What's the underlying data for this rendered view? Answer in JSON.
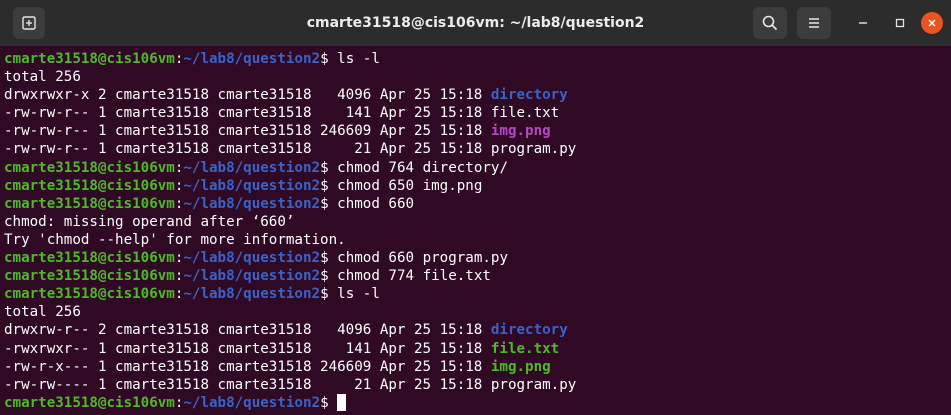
{
  "window": {
    "title": "cmarte31518@cis106vm: ~/lab8/question2",
    "icons": {
      "new_tab": "new-tab-icon",
      "search": "search-icon",
      "menu": "hamburger-menu-icon",
      "minimize": "minimize-icon",
      "maximize": "maximize-icon",
      "close": "close-icon"
    }
  },
  "colors": {
    "background": "#300a24",
    "titlebar": "#2c2c2c",
    "prompt_user": "#4dba27",
    "prompt_path": "#3a63c9",
    "directory": "#3a63c9",
    "image": "#b748c4",
    "executable": "#4dba27",
    "close_button": "#e95420"
  },
  "prompt": {
    "user_host": "cmarte31518@cis106vm",
    "colon": ":",
    "path": "~/lab8/question2",
    "dollar": "$"
  },
  "lines": [
    {
      "kind": "prompt",
      "cmd": " ls -l"
    },
    {
      "kind": "text",
      "text": "total 256"
    },
    {
      "kind": "ls",
      "meta": "drwxrwxr-x 2 cmarte31518 cmarte31518   4096 Apr 25 15:18 ",
      "name": "directory",
      "type": "dir"
    },
    {
      "kind": "ls",
      "meta": "-rw-rw-r-- 1 cmarte31518 cmarte31518    141 Apr 25 15:18 ",
      "name": "file.txt",
      "type": "plain"
    },
    {
      "kind": "ls",
      "meta": "-rw-rw-r-- 1 cmarte31518 cmarte31518 246609 Apr 25 15:18 ",
      "name": "img.png",
      "type": "pic"
    },
    {
      "kind": "ls",
      "meta": "-rw-rw-r-- 1 cmarte31518 cmarte31518     21 Apr 25 15:18 ",
      "name": "program.py",
      "type": "plain"
    },
    {
      "kind": "prompt",
      "cmd": " chmod 764 directory/"
    },
    {
      "kind": "prompt",
      "cmd": " chmod 650 img.png"
    },
    {
      "kind": "prompt",
      "cmd": " chmod 660"
    },
    {
      "kind": "text",
      "text": "chmod: missing operand after ‘660’"
    },
    {
      "kind": "text",
      "text": "Try 'chmod --help' for more information."
    },
    {
      "kind": "prompt",
      "cmd": " chmod 660 program.py"
    },
    {
      "kind": "prompt",
      "cmd": " chmod 774 file.txt"
    },
    {
      "kind": "prompt",
      "cmd": " ls -l"
    },
    {
      "kind": "text",
      "text": "total 256"
    },
    {
      "kind": "ls",
      "meta": "drwxrw-r-- 2 cmarte31518 cmarte31518   4096 Apr 25 15:18 ",
      "name": "directory",
      "type": "dir"
    },
    {
      "kind": "ls",
      "meta": "-rwxrwxr-- 1 cmarte31518 cmarte31518    141 Apr 25 15:18 ",
      "name": "file.txt",
      "type": "exe"
    },
    {
      "kind": "ls",
      "meta": "-rw-r-x--- 1 cmarte31518 cmarte31518 246609 Apr 25 15:18 ",
      "name": "img.png",
      "type": "exe"
    },
    {
      "kind": "ls",
      "meta": "-rw-rw---- 1 cmarte31518 cmarte31518     21 Apr 25 15:18 ",
      "name": "program.py",
      "type": "plain"
    },
    {
      "kind": "prompt",
      "cmd": " ",
      "cursor": true
    }
  ]
}
